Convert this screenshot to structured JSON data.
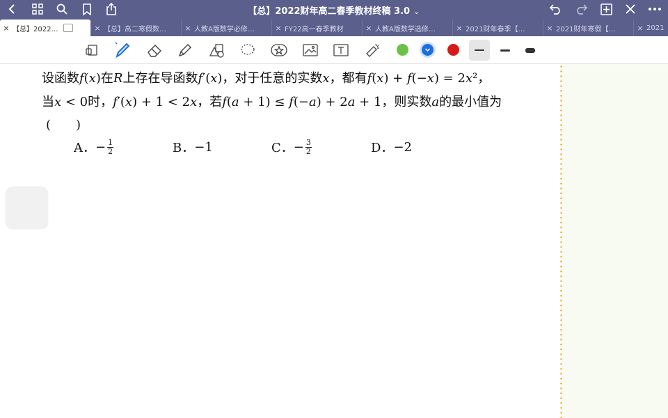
{
  "titlebar": {
    "title": "【总】2022财年高二春季教材终稿 3.0",
    "title_chevron": "⌄"
  },
  "tabs": [
    {
      "label": "【总】2022…",
      "active": true
    },
    {
      "label": "【总】高二寒假数…",
      "active": false
    },
    {
      "label": "人教A版数学必修…",
      "active": false
    },
    {
      "label": "FY22高一春季教材",
      "active": false
    },
    {
      "label": "人教A版数学选修…",
      "active": false
    },
    {
      "label": "2021财年春季【…",
      "active": false
    },
    {
      "label": "2021财年寒假【…",
      "active": false
    },
    {
      "label": "2021",
      "active": false
    }
  ],
  "tab_close_glyph": "×",
  "colors": {
    "green": "#6cc04a",
    "blue": "#1d6fe0",
    "red": "#d71a1a",
    "titlebar_bg": "#5a5f8c"
  },
  "question": {
    "line1": {
      "a": "设函数",
      "b": "f",
      "c": "(",
      "d": "x",
      "e": ")在",
      "f": "R",
      "g": "上存在导函数",
      "h": "f",
      "i": "′(",
      "j": "x",
      "k": ")，对于任意的实数",
      "l": "x",
      "m": "，都有",
      "n": "f",
      "o": "(",
      "p": "x",
      "q": ") + ",
      "r": "f",
      "s": "(−",
      "t": "x",
      "u": ") = 2",
      "v": "x",
      "w": "²，"
    },
    "line2": {
      "a": "当",
      "b": "x",
      "c": " < 0时，",
      "d": "f",
      "e": "′(",
      "f": "x",
      "g": ") + 1 < 2",
      "h": "x",
      "i": "，若",
      "j": "f",
      "k": "(",
      "l": "a",
      "m": " + 1) ≤ ",
      "n": "f",
      "o": "(−",
      "p": "a",
      "q": ") + 2",
      "r": "a",
      "s": " + 1，则实数",
      "t": "a",
      "u": "的最小值为"
    },
    "line3": "(　　)",
    "options": [
      {
        "letter": "A．",
        "sign": "−",
        "num": "1",
        "den": "2"
      },
      {
        "letter": "B．",
        "text": "−1"
      },
      {
        "letter": "C．",
        "sign": "−",
        "num": "3",
        "den": "2"
      },
      {
        "letter": "D．",
        "text": "−2"
      }
    ]
  }
}
